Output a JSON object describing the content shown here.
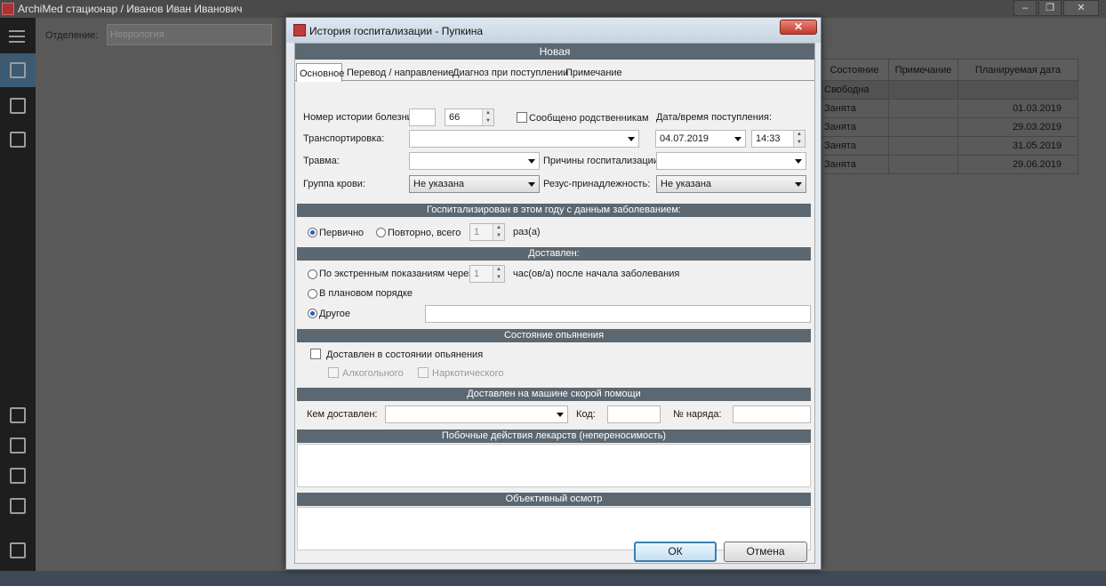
{
  "main_window": {
    "title": "ArchiMed стационар / Иванов Иван Иванович",
    "department_label": "Отделение:",
    "department_value": "Неврология",
    "minimize": "–",
    "restore": "❐",
    "close": "✕",
    "table": {
      "headers": [
        "Состояние",
        "Примечание",
        "Планируемая дата"
      ],
      "rows": [
        {
          "state": "Свободна",
          "note": "",
          "date": ""
        },
        {
          "state": "Занята",
          "note": "",
          "date": "01.03.2019"
        },
        {
          "state": "Занята",
          "note": "",
          "date": "29.03.2019"
        },
        {
          "state": "Занята",
          "note": "",
          "date": "31.05.2019"
        },
        {
          "state": "Занята",
          "note": "",
          "date": "29.06.2019"
        }
      ]
    }
  },
  "dialog": {
    "title": "История госпитализации - Пупкина",
    "close": "✕",
    "header": "Новая",
    "tabs": [
      "Основное",
      "Перевод / направление",
      "Диагноз при поступлении",
      "Примечание"
    ],
    "history_number_label": "Номер истории болезни:",
    "history_number_prefix": "",
    "history_number_value": "66",
    "relatives_informed_label": "Сообщено родственникам",
    "admission_datetime_label": "Дата/время поступления:",
    "admission_date": "04.07.2019",
    "admission_time": "14:33",
    "transport_label": "Транспортировка:",
    "transport_value": "",
    "trauma_label": "Травма:",
    "trauma_value": "",
    "reasons_label": "Причины госпитализации:",
    "reasons_value": "",
    "blood_group_label": "Группа крови:",
    "blood_group_value": "Не указана",
    "rhesus_label": "Резус-принадлежность:",
    "rhesus_value": "Не указана",
    "section_hospitalized_year": "Госпитализирован в этом году с данным заболеванием:",
    "first_time_label": "Первично",
    "repeat_label": "Повторно, всего",
    "repeat_count": "1",
    "times_label": "раз(а)",
    "section_delivered": "Доставлен:",
    "emergency_label": "По экстренным  показаниям через",
    "emergency_hours": "1",
    "hours_after_label": "час(ов/а) после начала заболевания",
    "planned_label": "В плановом порядке",
    "other_label": "Другое",
    "other_value": "",
    "section_intoxication": "Состояние опьянения",
    "intoxicated_label": "Доставлен в состоянии опьянения",
    "alcohol_label": "Алкогольного",
    "narcotic_label": "Наркотического",
    "section_ambulance": "Доставлен на машине скорой помощи",
    "delivered_by_label": "Кем доставлен:",
    "delivered_by_value": "",
    "code_label": "Код:",
    "code_value": "",
    "order_number_label": "№ наряда:",
    "order_number_value": "",
    "section_side_effects": "Побочные действия лекарств (непереносимость)",
    "side_effects_value": "",
    "section_exam": "Объективный осмотр",
    "exam_value": "",
    "ok_label": "ОК",
    "cancel_label": "Отмена"
  }
}
